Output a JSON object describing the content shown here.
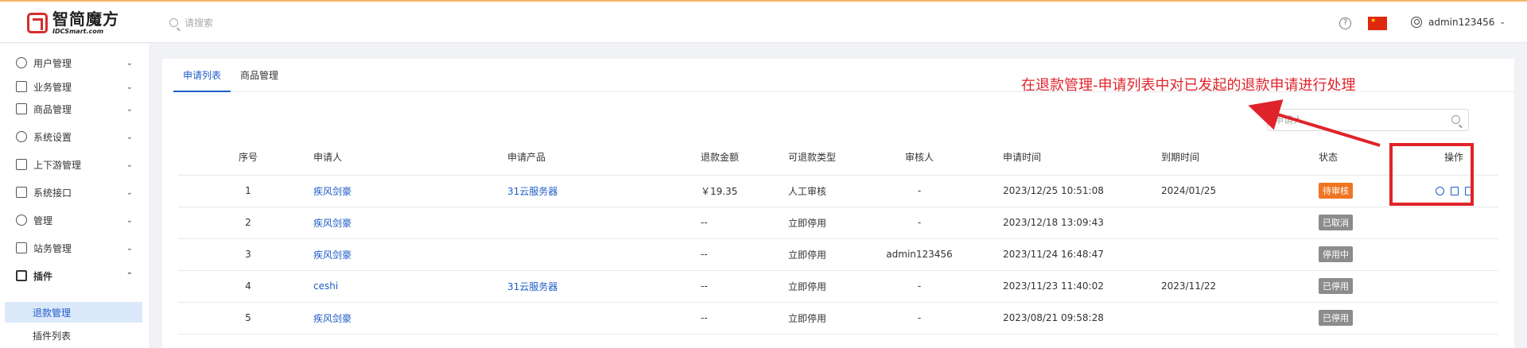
{
  "header": {
    "logo_cn": "智简魔方",
    "logo_en": "IDCSmart.com",
    "search_placeholder": "请搜索",
    "help_icon": "question-circle-icon",
    "flag_icon": "china-flag-icon",
    "user_name": "admin123456",
    "accent_color": "#1e5cc7",
    "brand_color": "#d72d2d"
  },
  "sidebar": {
    "items": [
      {
        "label": "用户管理",
        "icon": "user-icon"
      },
      {
        "label": "业务管理",
        "icon": "list-icon"
      },
      {
        "label": "商品管理",
        "icon": "cart-icon"
      },
      {
        "label": "系统设置",
        "icon": "gear-icon"
      },
      {
        "label": "上下游管理",
        "icon": "filter-icon"
      },
      {
        "label": "系统接口",
        "icon": "folder-icon"
      },
      {
        "label": "管理",
        "icon": "sun-icon"
      },
      {
        "label": "站务管理",
        "icon": "window-icon"
      },
      {
        "label": "插件",
        "icon": "cube-icon"
      }
    ],
    "sub_items": [
      {
        "label": "退款管理",
        "active": true
      },
      {
        "label": "插件列表",
        "active": false
      }
    ]
  },
  "main": {
    "tabs": [
      {
        "label": "申请列表",
        "active": true
      },
      {
        "label": "商品管理",
        "active": false
      }
    ],
    "filter_placeholder": "申请人",
    "table": {
      "columns": [
        "序号",
        "申请人",
        "申请产品",
        "退款金额",
        "可退款类型",
        "审核人",
        "申请时间",
        "到期时间",
        "状态",
        "操作"
      ],
      "rows": [
        {
          "no": "1",
          "applicant": "疾风剑豪",
          "product": "31云服务器",
          "amount": "￥19.35",
          "type": "人工审核",
          "reviewer": "-",
          "apply_time": "2023/12/25 10:51:08",
          "expire_time": "2024/01/25",
          "status": "待审核",
          "status_color": "#f07522"
        },
        {
          "no": "2",
          "applicant": "疾风剑豪",
          "product": "",
          "amount": "--",
          "type": "立即停用",
          "reviewer": "-",
          "apply_time": "2023/12/18 13:09:43",
          "expire_time": "",
          "status": "已取消",
          "status_color": "#8c8c8c"
        },
        {
          "no": "3",
          "applicant": "疾风剑豪",
          "product": "",
          "amount": "--",
          "type": "立即停用",
          "reviewer": "admin123456",
          "apply_time": "2023/11/24 16:48:47",
          "expire_time": "",
          "status": "停用中",
          "status_color": "#8c8c8c"
        },
        {
          "no": "4",
          "applicant": "ceshi",
          "product": "31云服务器",
          "amount": "--",
          "type": "立即停用",
          "reviewer": "-",
          "apply_time": "2023/11/23 11:40:02",
          "expire_time": "2023/11/22",
          "status": "已停用",
          "status_color": "#8c8c8c"
        },
        {
          "no": "5",
          "applicant": "疾风剑豪",
          "product": "",
          "amount": "--",
          "type": "立即停用",
          "reviewer": "-",
          "apply_time": "2023/08/21 09:58:28",
          "expire_time": "",
          "status": "已停用",
          "status_color": "#8c8c8c"
        }
      ],
      "row_actions": [
        "approve-icon",
        "document-icon",
        "reject-icon"
      ]
    }
  },
  "annotation": {
    "text": "在退款管理-申请列表中对已发起的退款申请进行处理",
    "color": "#e0232a"
  }
}
